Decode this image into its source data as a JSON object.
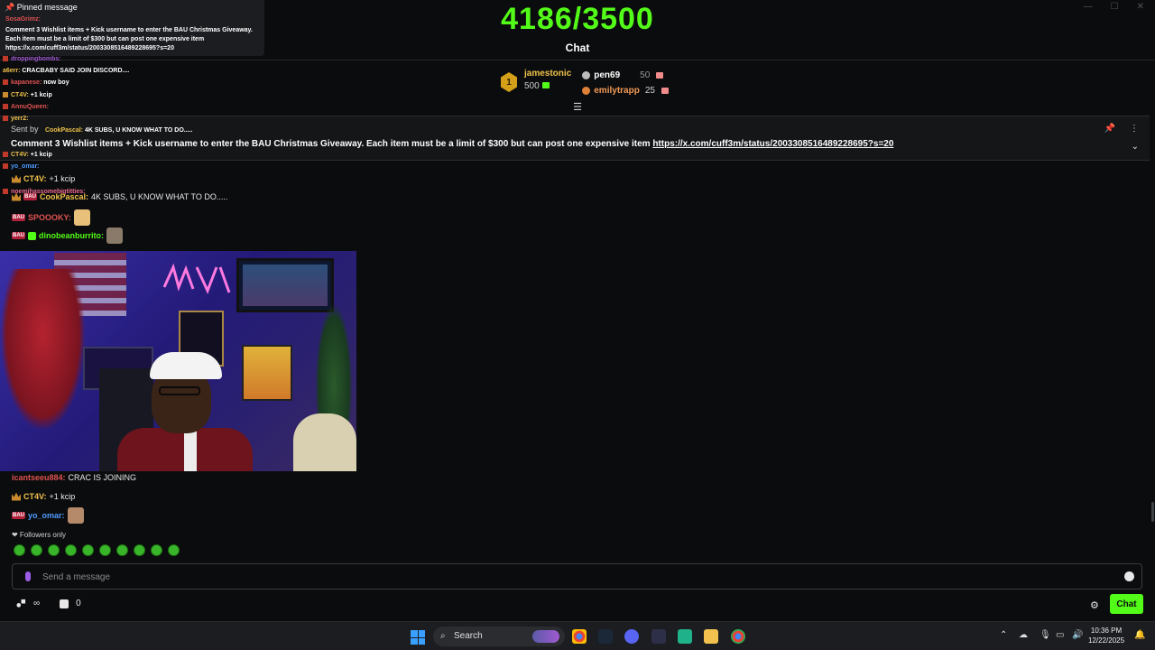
{
  "header": {
    "goal_text": "4186/3500",
    "chat_title": "Chat"
  },
  "leaderboard": {
    "rank1": {
      "rank": "1",
      "name": "jamestonic",
      "amount": "500"
    },
    "rank2": {
      "name": "pen69",
      "amount": "50"
    },
    "rank3": {
      "name": "emilytrapp",
      "amount": "25"
    }
  },
  "pinned_overlay": {
    "title": "📌 Pinned message",
    "user": "SosaGrimz:",
    "body": "Comment 3 Wishlist items + Kick username to enter the BAU Christmas Giveaway. Each item must be a limit of $300 but can post one expensive item https://x.com/cuff3m/status/2003308516489228695?s=20"
  },
  "pinned_banner": {
    "sent_by": "Sent by",
    "text": "Comment 3 Wishlist items + Kick username to enter the BAU Christmas Giveaway. Each item must be a limit of $300 but can post one expensive item ",
    "link": "https://x.com/cuff3m/status/2003308516489228695?s=20"
  },
  "overlay_chat": [
    {
      "user": "droppingbombs:",
      "text": ""
    },
    {
      "user": "a6err:",
      "text": "CRACBABY SAID JOIN DISCORD...."
    },
    {
      "user": "kapanese:",
      "text": "now boy"
    },
    {
      "user": "CT4V:",
      "text": "+1 kcip"
    },
    {
      "user": "AnnuQueen:",
      "text": ""
    },
    {
      "user": "yerr2:",
      "text": ""
    },
    {
      "user": "CookPascal:",
      "text": "4K SUBS, U KNOW WHAT TO DO....."
    },
    {
      "user": "yo_omar:",
      "text": ""
    },
    {
      "user": "CT4V:",
      "text": "+1 kcip"
    },
    {
      "user": "noemihassomebigtitties:",
      "text": ""
    }
  ],
  "chat": {
    "m1": {
      "user": "CT4V:",
      "text": "+1 kcip"
    },
    "m2": {
      "user": "CookPascal:",
      "text": "4K SUBS, U KNOW WHAT TO DO....."
    },
    "m3": {
      "user": "SPOOOKY:",
      "text": ""
    },
    "m4": {
      "user": "dinobeanburrito:",
      "text": ""
    },
    "m5": {
      "user": "icantseeu884:",
      "text": "CRAC IS JOINING"
    },
    "m6": {
      "user": "CT4V:",
      "text": "+1 kcip"
    },
    "m7": {
      "user": "yo_omar:",
      "text": ""
    },
    "badge_text": "BAU"
  },
  "followers_only": "❤ Followers only",
  "input": {
    "placeholder": "Send a message"
  },
  "bottom": {
    "kicks_count": "0",
    "chat_button": "Chat"
  },
  "taskbar": {
    "search_label": "Search",
    "time": "10:36 PM",
    "date": "12/22/2025"
  },
  "colors": {
    "accent": "#53fc18",
    "background": "#0b0c0d"
  }
}
